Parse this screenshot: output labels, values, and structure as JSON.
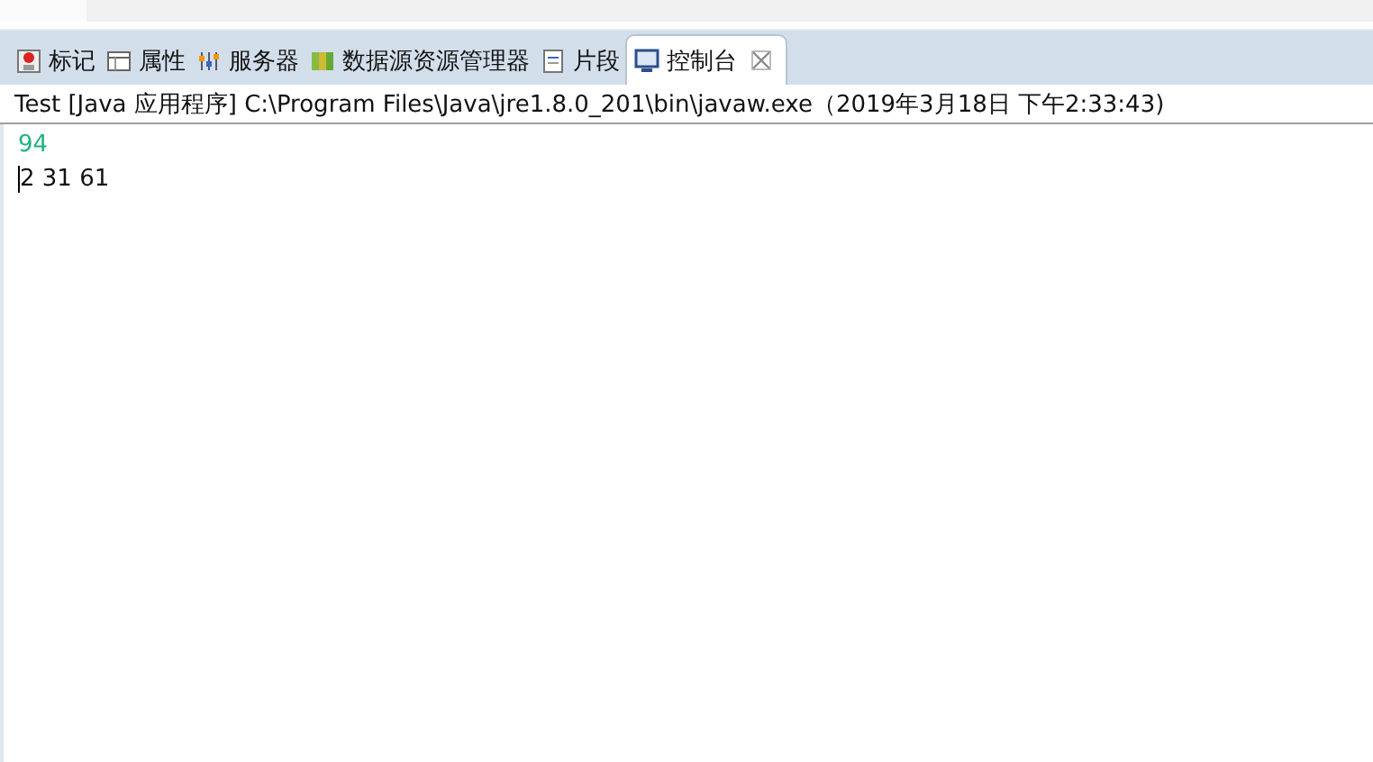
{
  "tabs": [
    {
      "label": "标记",
      "kind": "marker",
      "selected": false
    },
    {
      "label": "属性",
      "kind": "properties",
      "selected": false
    },
    {
      "label": "服务器",
      "kind": "servers",
      "selected": false
    },
    {
      "label": "数据源资源管理器",
      "kind": "datasource",
      "selected": false
    },
    {
      "label": "片段",
      "kind": "snippets",
      "selected": false
    },
    {
      "label": "控制台",
      "kind": "console",
      "selected": true
    }
  ],
  "console": {
    "header": "Test [Java 应用程序] C:\\Program Files\\Java\\jre1.8.0_201\\bin\\javaw.exe（2019年3月18日 下午2:33:43)",
    "lines": [
      {
        "text": "94",
        "kind": "input",
        "cursor": false
      },
      {
        "text": "2 31 61",
        "kind": "output",
        "cursor": true
      }
    ]
  }
}
